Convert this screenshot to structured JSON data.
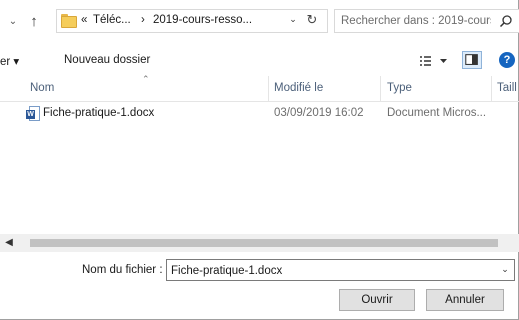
{
  "address": {
    "crumbs": [
      "«",
      "Téléc...",
      "›",
      "2019-cours-resso..."
    ]
  },
  "search": {
    "placeholder": "Rechercher dans : 2019-cours..."
  },
  "toolbar": {
    "organize_label": "er ▾",
    "new_folder_label": "Nouveau dossier"
  },
  "columns": {
    "name": "Nom",
    "modified": "Modifié le",
    "type": "Type",
    "size": "Taill"
  },
  "files": [
    {
      "name": "Fiche-pratique-1.docx",
      "modified": "03/09/2019 16:02",
      "type": "Document Micros..."
    }
  ],
  "filename": {
    "label": "Nom du fichier :",
    "value": "Fiche-pratique-1.docx"
  },
  "buttons": {
    "open": "Ouvrir",
    "cancel": "Annuler"
  },
  "icons": {
    "nav_down": "chevron-down-icon",
    "nav_up": "arrow-up-icon",
    "folder": "folder-icon",
    "refresh": "refresh-icon",
    "search": "search-icon",
    "view": "view-options-icon",
    "preview_pane": "preview-pane-icon",
    "help": "help-icon",
    "word_doc": "word-document-icon"
  },
  "colors": {
    "header_text": "#4c607a",
    "muted_text": "#6d6d6d",
    "help_blue": "#1565c0",
    "folder_yellow": "#f5cd5b"
  }
}
